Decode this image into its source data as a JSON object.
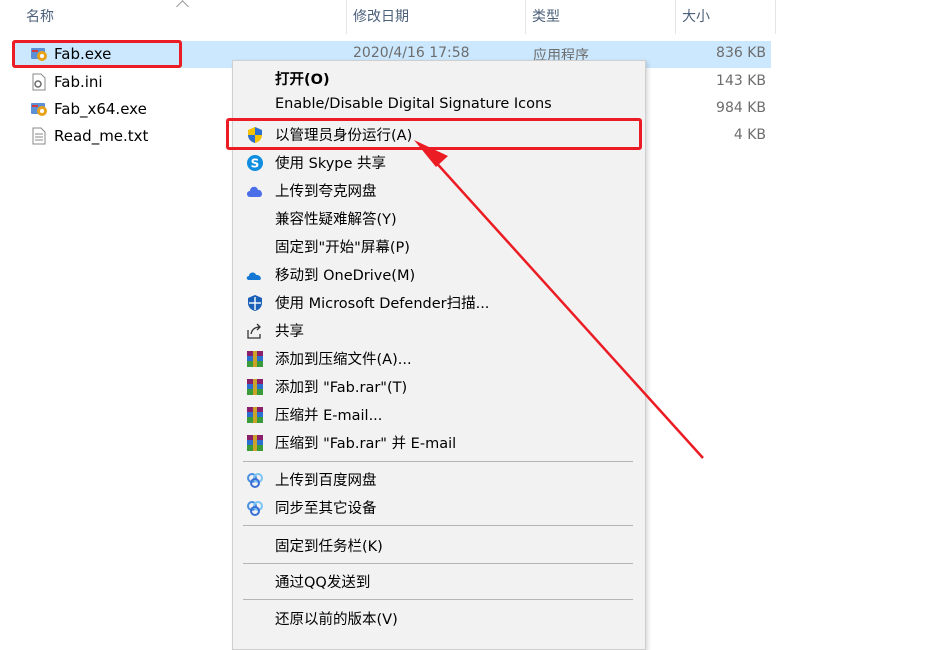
{
  "columns": {
    "name": "名称",
    "date": "修改日期",
    "type": "类型",
    "size": "大小"
  },
  "files": [
    {
      "name": "Fab.exe",
      "date": "2020/4/16 17:58",
      "type": "应用程序",
      "size": "836 KB",
      "selected": true,
      "icon": "exe-app-icon"
    },
    {
      "name": "Fab.ini",
      "date": "",
      "type": "",
      "size": "143 KB",
      "icon": "ini-settings-file-icon"
    },
    {
      "name": "Fab_x64.exe",
      "date": "",
      "type": "",
      "size": "984 KB",
      "icon": "exe-app-icon"
    },
    {
      "name": "Read_me.txt",
      "date": "",
      "type": "",
      "size": "4 KB",
      "icon": "text-file-icon"
    }
  ],
  "context_menu": {
    "items": [
      {
        "label": "打开(O)",
        "bold": true,
        "icon": ""
      },
      {
        "label": "Enable/Disable Digital Signature Icons",
        "icon": ""
      },
      {
        "label": "以管理员身份运行(A)",
        "icon": "uac-shield-icon",
        "highlighted": true
      },
      {
        "label": "使用 Skype 共享",
        "icon": "skype-icon"
      },
      {
        "label": "上传到夸克网盘",
        "icon": "quark-cloud-icon"
      },
      {
        "label": "兼容性疑难解答(Y)",
        "icon": ""
      },
      {
        "label": "固定到\"开始\"屏幕(P)",
        "icon": ""
      },
      {
        "label": "移动到 OneDrive(M)",
        "icon": "onedrive-icon"
      },
      {
        "label": "使用 Microsoft Defender扫描...",
        "icon": "defender-shield-icon"
      },
      {
        "label": "共享",
        "icon": "share-icon"
      },
      {
        "label": "添加到压缩文件(A)...",
        "icon": "winrar-icon"
      },
      {
        "label": "添加到 \"Fab.rar\"(T)",
        "icon": "winrar-icon"
      },
      {
        "label": "压缩并 E-mail...",
        "icon": "winrar-icon"
      },
      {
        "label": "压缩到 \"Fab.rar\" 并 E-mail",
        "icon": "winrar-icon"
      },
      {
        "label": "上传到百度网盘",
        "icon": "baidu-netdisk-icon"
      },
      {
        "label": "同步至其它设备",
        "icon": "baidu-netdisk-icon"
      },
      {
        "label": "固定到任务栏(K)",
        "icon": ""
      },
      {
        "label": "通过QQ发送到",
        "icon": ""
      },
      {
        "label": "还原以前的版本(V)",
        "icon": ""
      }
    ]
  },
  "colors": {
    "annotation_red": "#ec1c24",
    "selection_blue": "#cce8ff",
    "menu_bg": "#f2f2f2"
  }
}
